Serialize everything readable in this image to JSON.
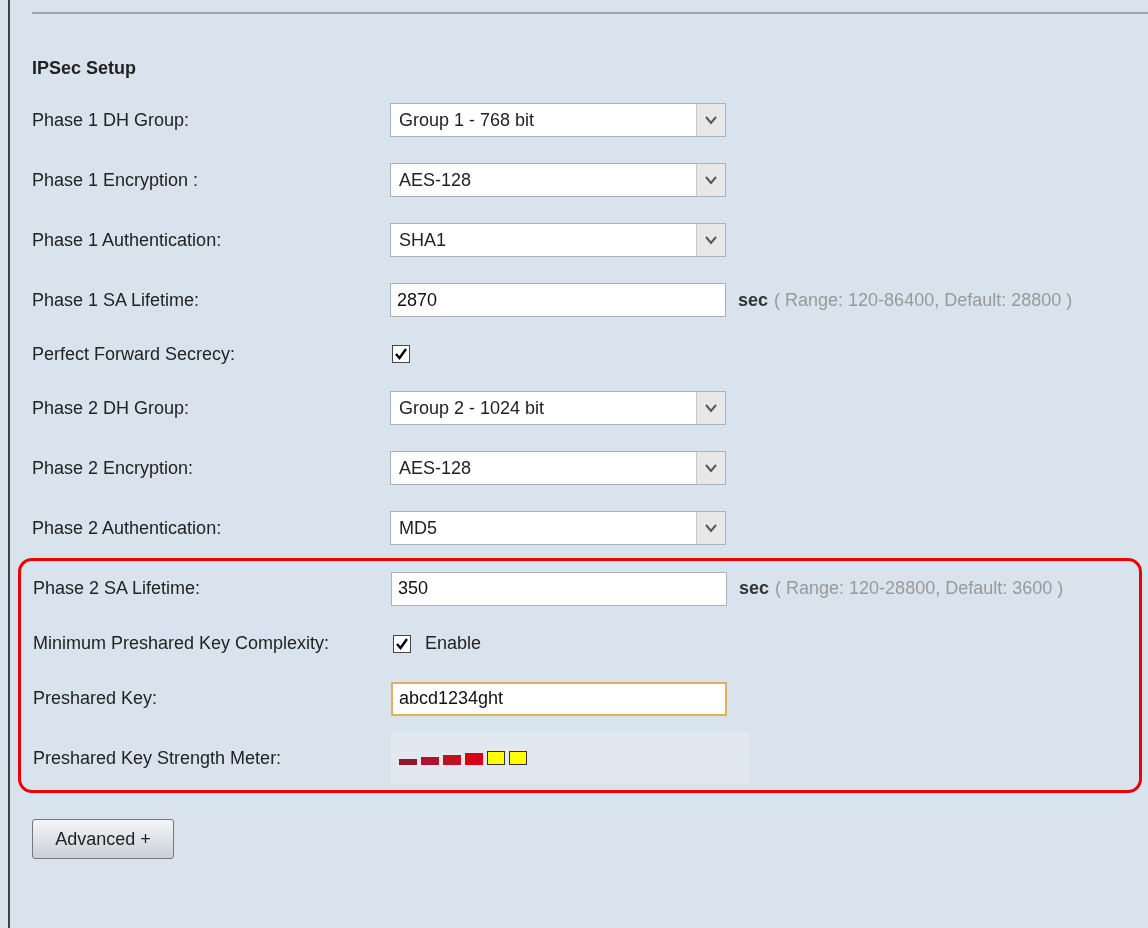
{
  "title": "IPSec Setup",
  "sections": [
    {
      "highlighted": false,
      "rows": [
        {
          "label": "Phase 1 DH Group:",
          "kind": "select",
          "value": "Group 1 - 768 bit"
        },
        {
          "label": "Phase 1 Encryption :",
          "kind": "select",
          "value": "AES-128"
        },
        {
          "label": "Phase 1 Authentication:",
          "kind": "select",
          "value": "SHA1"
        },
        {
          "label": "Phase 1 SA Lifetime:",
          "kind": "text",
          "value": "2870",
          "focused": false,
          "unit": "sec",
          "hint": "( Range: 120-86400, Default: 28800 )"
        },
        {
          "label": "Perfect Forward Secrecy:",
          "kind": "checkbox",
          "checked": true
        },
        {
          "label": "Phase 2 DH Group:",
          "kind": "select",
          "value": "Group 2 - 1024 bit"
        },
        {
          "label": "Phase 2 Encryption:",
          "kind": "select",
          "value": "AES-128"
        },
        {
          "label": "Phase 2 Authentication:",
          "kind": "select",
          "value": "MD5"
        }
      ]
    },
    {
      "highlighted": true,
      "rows": [
        {
          "label": "Phase 2 SA Lifetime:",
          "kind": "text",
          "value": "350",
          "focused": false,
          "unit": "sec",
          "hint": "( Range: 120-28800, Default: 3600 )"
        },
        {
          "label": "Minimum Preshared Key Complexity:",
          "kind": "checkbox",
          "checked": true,
          "text": "Enable"
        },
        {
          "label": "Preshared Key:",
          "kind": "text",
          "value": "abcd1234ght",
          "focused": true
        },
        {
          "label": "Preshared Key Strength Meter:",
          "kind": "meter",
          "bars": [
            {
              "color": "#8b1a2e"
            },
            {
              "color": "#b0102a"
            },
            {
              "color": "#c0101e"
            },
            {
              "color": "#d80012"
            },
            {
              "color": "#ffff00"
            },
            {
              "color": "#ffff00"
            }
          ]
        }
      ]
    }
  ],
  "button": "Advanced +"
}
